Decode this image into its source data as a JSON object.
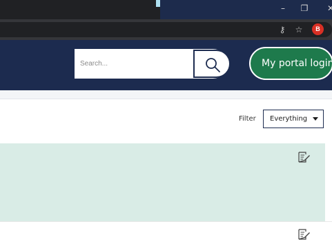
{
  "browser": {
    "minimize_glyph": "–",
    "restore_glyph": "❐",
    "close_glyph": "✕",
    "key_glyph": "⚷",
    "star_glyph": "☆",
    "profile_initial": "B"
  },
  "header": {
    "search_placeholder": "Search...",
    "portal_button_label": "My portal login"
  },
  "filter": {
    "label": "Filter",
    "selected": "Everything"
  },
  "colors": {
    "header_bg": "#1c2b4f",
    "portal_green": "#1e7a4c",
    "card_bg": "#d9ece6"
  },
  "icons": [
    "search-icon",
    "edit-icon",
    "caret-down-icon",
    "key-icon",
    "star-icon"
  ]
}
